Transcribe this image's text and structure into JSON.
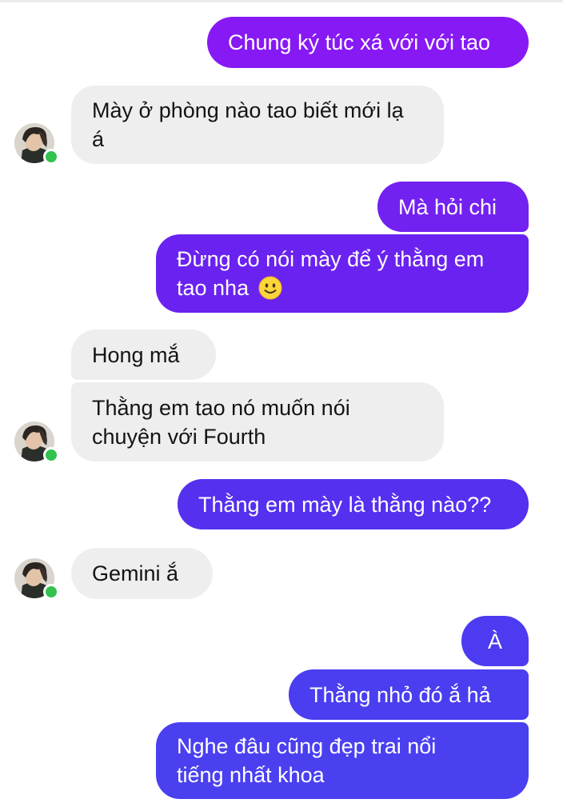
{
  "colors": {
    "bubble_out_top": "#8b19f5",
    "bubble_out_mid": "#6b22f0",
    "bubble_out_bottom": "#4a3ef0",
    "bubble_in": "#eeeeee",
    "online_dot": "#32c24d",
    "text_out": "#ffffff",
    "text_in": "#141414"
  },
  "messages": [
    {
      "side": "out",
      "text": "Chung ký túc xá với với tao"
    },
    {
      "side": "in",
      "text": "Mày ở phòng nào tao biết mới lạ á"
    },
    {
      "side": "out",
      "text": "Mà hỏi chi"
    },
    {
      "side": "out",
      "text": "Đừng có nói mày để ý thằng em tao nha",
      "emoji": "slightly-smiling-face-icon"
    },
    {
      "side": "in",
      "text": "Hong mắ"
    },
    {
      "side": "in",
      "text": "Thằng em tao nó muốn nói chuyện với Fourth"
    },
    {
      "side": "out",
      "text": "Thằng em mày là thằng nào??"
    },
    {
      "side": "in",
      "text": "Gemini ắ"
    },
    {
      "side": "out",
      "text": "À"
    },
    {
      "side": "out",
      "text": "Thằng nhỏ đó ắ hả"
    },
    {
      "side": "out",
      "text": "Nghe đâu cũng đẹp trai nổi tiếng nhất khoa"
    }
  ]
}
